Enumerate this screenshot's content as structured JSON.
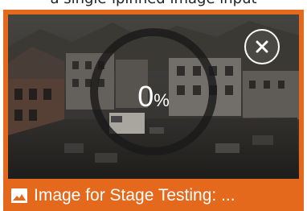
{
  "top_text": "a single-lpinned image input",
  "upload": {
    "progress_label": "0",
    "progress_unit": "%",
    "progress_fraction": 0.0
  },
  "caption": {
    "text": "Image for Stage Testing: ...",
    "icon": "image-icon"
  },
  "controls": {
    "close_icon": "close-icon"
  },
  "colors": {
    "card_accent": "#e4691c",
    "progress_ring": "#1a1a1a",
    "text": "#ffffff"
  }
}
